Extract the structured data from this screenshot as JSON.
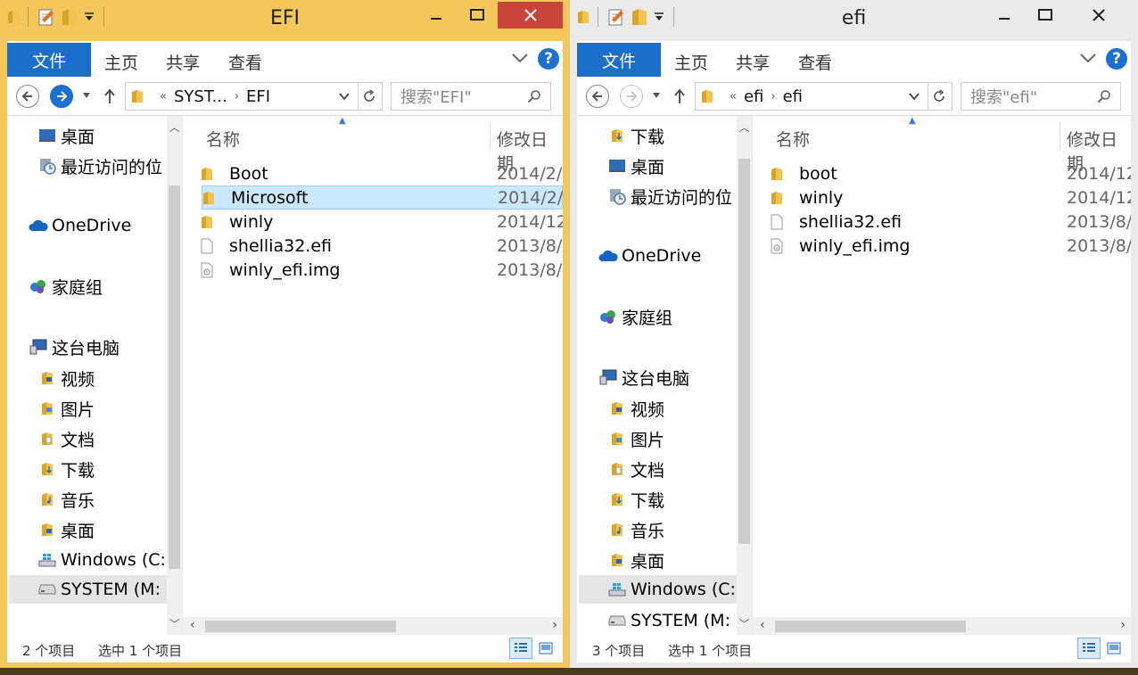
{
  "left": {
    "title": "EFI",
    "ribbon": {
      "file": "文件",
      "home": "主页",
      "share": "共享",
      "view": "查看"
    },
    "address": {
      "overflow": "«",
      "segments": [
        "SYST...",
        "EFI"
      ]
    },
    "search": {
      "placeholder": "搜索\"EFI\""
    },
    "nav": [
      "桌面",
      "最近访问的位",
      "OneDrive",
      "家庭组",
      "这台电脑",
      "视频",
      "图片",
      "文档",
      "下载",
      "音乐",
      "桌面",
      "Windows (C:",
      "SYSTEM (M:"
    ],
    "columns": {
      "name": "名称",
      "modified": "修改日期"
    },
    "files": [
      {
        "name": "Boot",
        "date": "2014/2/"
      },
      {
        "name": "Microsoft",
        "date": "2014/2/"
      },
      {
        "name": "winly",
        "date": "2014/12"
      },
      {
        "name": "shellia32.efi",
        "date": "2013/8/"
      },
      {
        "name": "winly_efi.img",
        "date": "2013/8/"
      }
    ],
    "status": {
      "count": "2 个项目",
      "selected": "选中 1 个项目"
    }
  },
  "right": {
    "title": "efi",
    "ribbon": {
      "file": "文件",
      "home": "主页",
      "share": "共享",
      "view": "查看"
    },
    "address": {
      "overflow": "«",
      "segments": [
        "efi",
        "efi"
      ]
    },
    "search": {
      "placeholder": "搜索\"efi\""
    },
    "nav": [
      "下载",
      "桌面",
      "最近访问的位",
      "OneDrive",
      "家庭组",
      "这台电脑",
      "视频",
      "图片",
      "文档",
      "下载",
      "音乐",
      "桌面",
      "Windows (C:",
      "SYSTEM (M:"
    ],
    "columns": {
      "name": "名称",
      "modified": "修改日期"
    },
    "files": [
      {
        "name": "boot",
        "date": "2014/12"
      },
      {
        "name": "winly",
        "date": "2014/12"
      },
      {
        "name": "shellia32.efi",
        "date": "2013/8/"
      },
      {
        "name": "winly_efi.img",
        "date": "2013/8/"
      }
    ],
    "status": {
      "count": "3 个项目",
      "selected": "选中 1 个项目"
    }
  },
  "icons": {
    "folder": "folder-icon",
    "file": "file-icon",
    "image-file": "disk-image-icon",
    "desktop": "desktop-icon",
    "recent": "recent-places-icon",
    "onedrive": "onedrive-icon",
    "homegroup": "homegroup-icon",
    "pc": "this-pc-icon",
    "drive": "drive-icon"
  },
  "colors": {
    "left_frame": "#f3c75c",
    "right_frame": "#eaeaea",
    "accent": "#1b6ec9",
    "close": "#c9453a",
    "selection": "#cce8ff"
  }
}
